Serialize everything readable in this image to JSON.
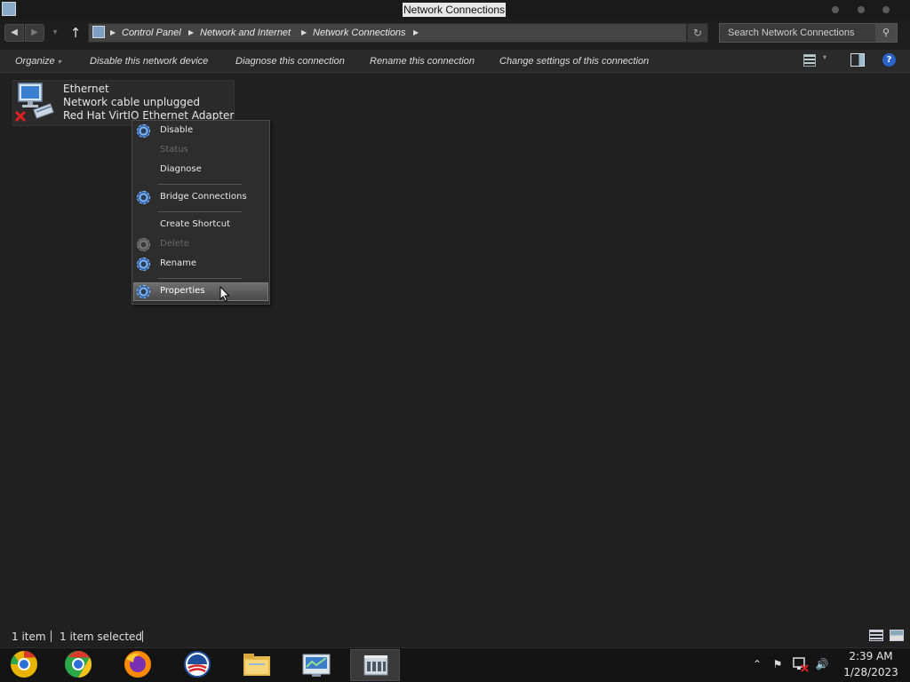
{
  "window": {
    "title": "Network Connections"
  },
  "address": {
    "crumbs": [
      "Control Panel",
      "Network and Internet",
      "Network Connections"
    ],
    "search_placeholder": "Search Network Connections"
  },
  "commands": {
    "organize": "Organize",
    "disable": "Disable this network device",
    "diagnose": "Diagnose this connection",
    "rename": "Rename this connection",
    "change_settings": "Change settings of this connection"
  },
  "connection": {
    "name": "Ethernet",
    "status": "Network cable unplugged",
    "adapter": "Red Hat VirtIO Ethernet Adapter"
  },
  "context_menu": {
    "items": [
      {
        "label": "Disable",
        "enabled": true,
        "shield_icon": true
      },
      {
        "label": "Status",
        "enabled": false,
        "shield_icon": false
      },
      {
        "label": "Diagnose",
        "enabled": true,
        "shield_icon": false
      },
      {
        "label": "Bridge Connections",
        "enabled": true,
        "shield_icon": true
      },
      {
        "label": "Create Shortcut",
        "enabled": true,
        "shield_icon": false
      },
      {
        "label": "Delete",
        "enabled": false,
        "shield_icon": true
      },
      {
        "label": "Rename",
        "enabled": true,
        "shield_icon": true
      },
      {
        "label": "Properties",
        "enabled": true,
        "shield_icon": true,
        "highlighted": true
      }
    ]
  },
  "status": {
    "count": "1 item",
    "selected": "1 item selected"
  },
  "taskbar": {
    "apps": [
      "chrome-canary-icon",
      "chrome-icon",
      "firefox-icon",
      "obama-campaign-icon",
      "file-explorer-icon",
      "network-monitor-icon",
      "control-panel-icon"
    ],
    "clock_time": "2:39 AM",
    "clock_date": "1/28/2023"
  }
}
